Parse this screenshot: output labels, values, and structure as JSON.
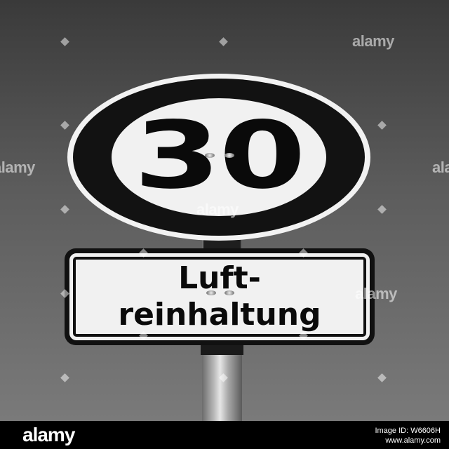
{
  "sign": {
    "speed_limit": "30",
    "plate_line_1": "Luft-",
    "plate_line_2": "reinhaltung"
  },
  "watermark": {
    "text": "alamy"
  },
  "footer": {
    "logo": "alamy",
    "image_id": "Image ID: W6606H",
    "site": "www.alamy.com"
  },
  "colors": {
    "sign_black": "#0a0a0a",
    "sign_white": "#f1f1f1",
    "footer_bg": "#000000"
  }
}
